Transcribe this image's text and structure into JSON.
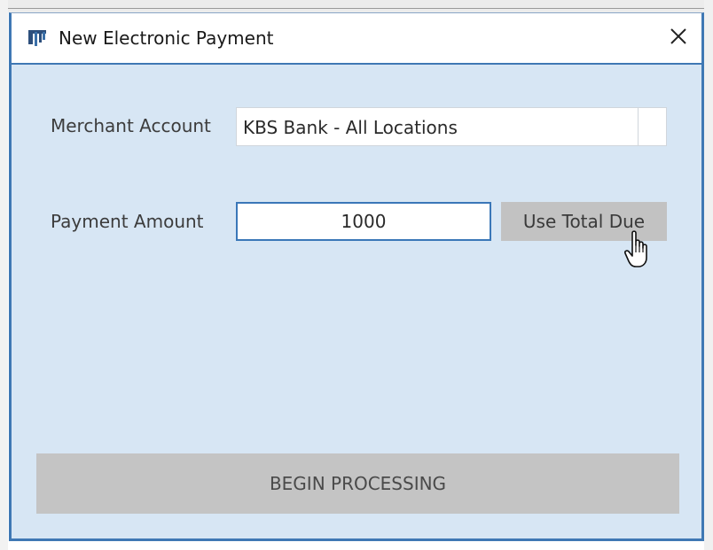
{
  "window": {
    "title": "New Electronic Payment",
    "app_icon": "app-logo-icon",
    "close_icon": "close-icon"
  },
  "form": {
    "merchant_account_label": "Merchant Account",
    "merchant_account_value": "KBS Bank - All Locations",
    "payment_amount_label": "Payment Amount",
    "payment_amount_value": "1000",
    "use_total_due_label": "Use Total Due"
  },
  "actions": {
    "begin_processing_label": "BEGIN PROCESSING"
  },
  "colors": {
    "dialog_background": "#d7e6f4",
    "accent_border": "#3f78b4",
    "button_gray": "#c2c2c2"
  }
}
